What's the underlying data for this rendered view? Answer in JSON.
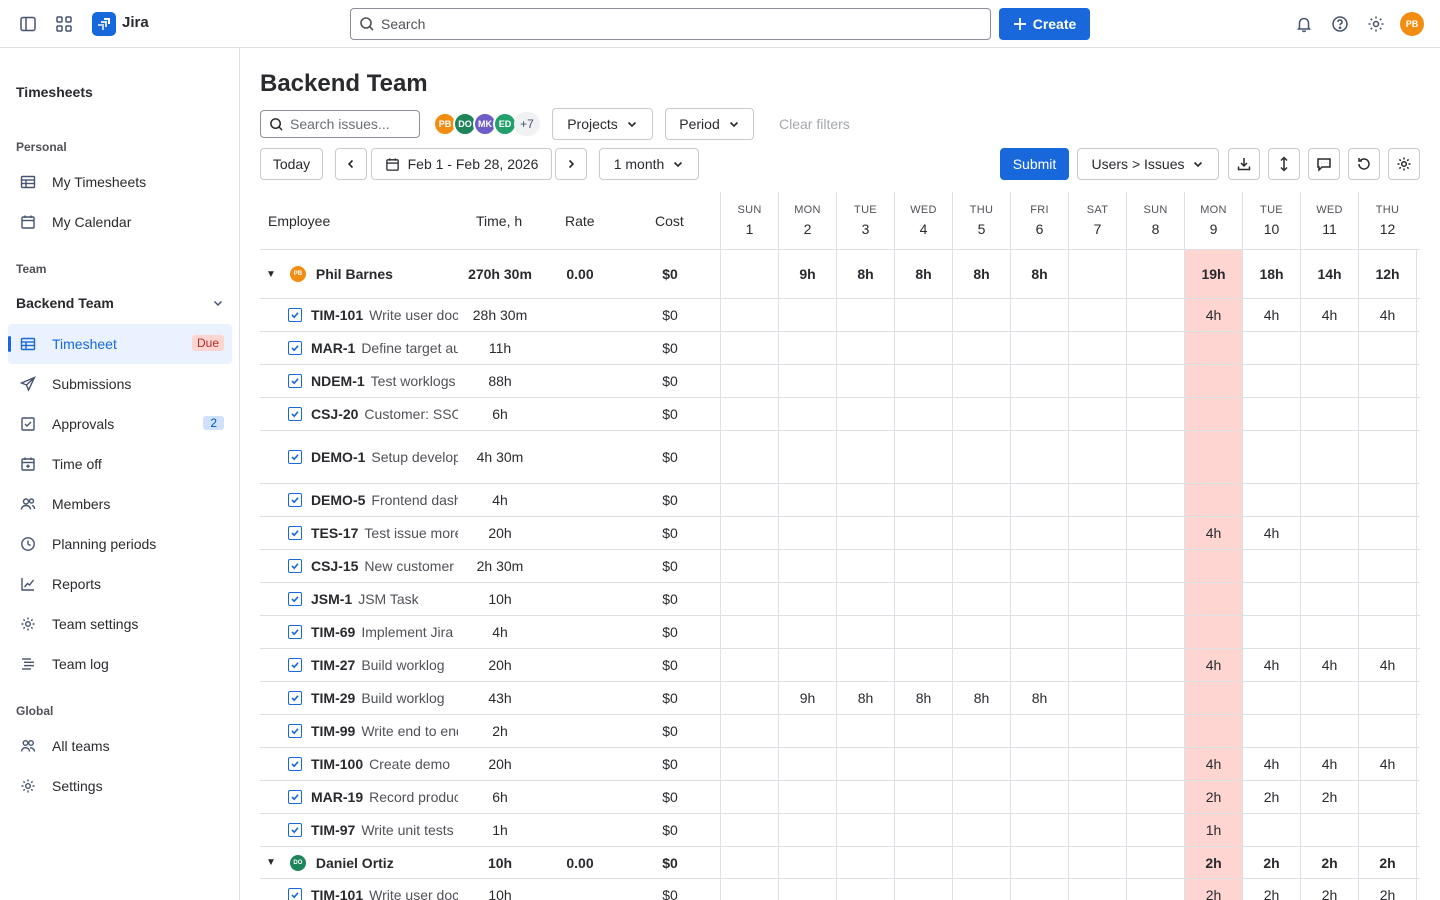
{
  "topbar": {
    "app_name": "Jira",
    "search_placeholder": "Search",
    "create_label": "Create",
    "user_initials": "PB"
  },
  "sidebar": {
    "title": "Timesheets",
    "section_personal": "Personal",
    "personal_items": [
      "My Timesheets",
      "My Calendar"
    ],
    "section_team": "Team",
    "team_name": "Backend Team",
    "team_items": [
      {
        "label": "Timesheet",
        "badge": "Due",
        "icon": "table-icon"
      },
      {
        "label": "Submissions",
        "badge": "",
        "icon": "send-icon"
      },
      {
        "label": "Approvals",
        "badge": "2",
        "icon": "check-square-icon"
      },
      {
        "label": "Time off",
        "badge": "",
        "icon": "calendar-plus-icon"
      },
      {
        "label": "Members",
        "badge": "",
        "icon": "people-icon"
      },
      {
        "label": "Planning periods",
        "badge": "",
        "icon": "clock-icon"
      },
      {
        "label": "Reports",
        "badge": "",
        "icon": "chart-icon"
      },
      {
        "label": "Team settings",
        "badge": "",
        "icon": "gear-icon"
      },
      {
        "label": "Team log",
        "badge": "",
        "icon": "list-icon"
      }
    ],
    "section_global": "Global",
    "global_items": [
      "All teams",
      "Settings"
    ]
  },
  "main": {
    "title": "Backend Team",
    "search_issues_placeholder": "Search issues...",
    "avatars": [
      {
        "initials": "PB",
        "color": "#f18d13"
      },
      {
        "initials": "DO",
        "color": "#1f845a"
      },
      {
        "initials": "MK",
        "color": "#6e5dc6"
      },
      {
        "initials": "ED",
        "color": "#22a06b"
      }
    ],
    "avatars_more": "+7",
    "projects_label": "Projects",
    "period_label": "Period",
    "clear_filters_label": "Clear filters",
    "today_label": "Today",
    "date_range": "Feb 1 - Feb 28, 2026",
    "span_label": "1 month",
    "submit_label": "Submit",
    "grouping_label": "Users > Issues"
  },
  "grid": {
    "columns": {
      "employee": "Employee",
      "time": "Time, h",
      "rate": "Rate",
      "cost": "Cost"
    },
    "days": [
      {
        "dow": "SUN",
        "dom": "1"
      },
      {
        "dow": "MON",
        "dom": "2"
      },
      {
        "dow": "TUE",
        "dom": "3"
      },
      {
        "dow": "WED",
        "dom": "4"
      },
      {
        "dow": "THU",
        "dom": "5"
      },
      {
        "dow": "FRI",
        "dom": "6"
      },
      {
        "dow": "SAT",
        "dom": "7"
      },
      {
        "dow": "SUN",
        "dom": "8"
      },
      {
        "dow": "MON",
        "dom": "9"
      },
      {
        "dow": "TUE",
        "dom": "10"
      },
      {
        "dow": "WED",
        "dom": "11"
      },
      {
        "dow": "THU",
        "dom": "12"
      }
    ],
    "highlight_day_index": 8,
    "highlight_color": "#ffd5d2",
    "rows": [
      {
        "type": "group",
        "name": "Phil Barnes",
        "initials": "PB",
        "avatar_color": "#f18d13",
        "time": "270h 30m",
        "rate": "0.00",
        "cost": "$0",
        "days": [
          "",
          "9h",
          "8h",
          "8h",
          "8h",
          "8h",
          "",
          "",
          "19h",
          "18h",
          "14h",
          "12h"
        ]
      },
      {
        "type": "issue",
        "key": "TIM-101",
        "summary": "Write user docs",
        "time": "28h 30m",
        "cost": "$0",
        "days": [
          "",
          "",
          "",
          "",
          "",
          "",
          "",
          "",
          "4h",
          "4h",
          "4h",
          "4h"
        ]
      },
      {
        "type": "issue",
        "key": "MAR-1",
        "summary": "Define target audience",
        "time": "11h",
        "cost": "$0",
        "days": [
          "",
          "",
          "",
          "",
          "",
          "",
          "",
          "",
          "",
          "",
          "",
          ""
        ]
      },
      {
        "type": "issue",
        "key": "NDEM-1",
        "summary": "Test worklogs",
        "time": "88h",
        "cost": "$0",
        "days": [
          "",
          "",
          "",
          "",
          "",
          "",
          "",
          "",
          "",
          "",
          "",
          ""
        ]
      },
      {
        "type": "issue",
        "key": "CSJ-20",
        "summary": "Customer: SSO",
        "time": "6h",
        "cost": "$0",
        "days": [
          "",
          "",
          "",
          "",
          "",
          "",
          "",
          "",
          "",
          "",
          "",
          ""
        ]
      },
      {
        "type": "issue",
        "key": "DEMO-1",
        "summary": "Setup development",
        "time": "4h 30m",
        "cost": "$0",
        "days": [
          "",
          "",
          "",
          "",
          "",
          "",
          "",
          "",
          "",
          "",
          "",
          ""
        ]
      },
      {
        "type": "issue",
        "key": "DEMO-5",
        "summary": "Frontend dashboard",
        "time": "4h",
        "cost": "$0",
        "days": [
          "",
          "",
          "",
          "",
          "",
          "",
          "",
          "",
          "",
          "",
          "",
          ""
        ]
      },
      {
        "type": "issue",
        "key": "TES-17",
        "summary": "Test issue more",
        "time": "20h",
        "cost": "$0",
        "days": [
          "",
          "",
          "",
          "",
          "",
          "",
          "",
          "",
          "4h",
          "4h",
          "",
          ""
        ]
      },
      {
        "type": "issue",
        "key": "CSJ-15",
        "summary": "New customer",
        "time": "2h 30m",
        "cost": "$0",
        "days": [
          "",
          "",
          "",
          "",
          "",
          "",
          "",
          "",
          "",
          "",
          "",
          ""
        ]
      },
      {
        "type": "issue",
        "key": "JSM-1",
        "summary": "JSM Task",
        "time": "10h",
        "cost": "$0",
        "days": [
          "",
          "",
          "",
          "",
          "",
          "",
          "",
          "",
          "",
          "",
          "",
          ""
        ]
      },
      {
        "type": "issue",
        "key": "TIM-69",
        "summary": "Implement Jira",
        "time": "4h",
        "cost": "$0",
        "days": [
          "",
          "",
          "",
          "",
          "",
          "",
          "",
          "",
          "",
          "",
          "",
          ""
        ]
      },
      {
        "type": "issue",
        "key": "TIM-27",
        "summary": "Build worklog",
        "time": "20h",
        "cost": "$0",
        "days": [
          "",
          "",
          "",
          "",
          "",
          "",
          "",
          "",
          "4h",
          "4h",
          "4h",
          "4h"
        ]
      },
      {
        "type": "issue",
        "key": "TIM-29",
        "summary": "Build worklog",
        "time": "43h",
        "cost": "$0",
        "days": [
          "",
          "9h",
          "8h",
          "8h",
          "8h",
          "8h",
          "",
          "",
          "",
          "",
          "",
          ""
        ]
      },
      {
        "type": "issue",
        "key": "TIM-99",
        "summary": "Write end to end",
        "time": "2h",
        "cost": "$0",
        "days": [
          "",
          "",
          "",
          "",
          "",
          "",
          "",
          "",
          "",
          "",
          "",
          ""
        ]
      },
      {
        "type": "issue",
        "key": "TIM-100",
        "summary": "Create demo",
        "time": "20h",
        "cost": "$0",
        "days": [
          "",
          "",
          "",
          "",
          "",
          "",
          "",
          "",
          "4h",
          "4h",
          "4h",
          "4h"
        ]
      },
      {
        "type": "issue",
        "key": "MAR-19",
        "summary": "Record product",
        "time": "6h",
        "cost": "$0",
        "days": [
          "",
          "",
          "",
          "",
          "",
          "",
          "",
          "",
          "2h",
          "2h",
          "2h",
          ""
        ]
      },
      {
        "type": "issue",
        "key": "TIM-97",
        "summary": "Write unit tests",
        "time": "1h",
        "cost": "$0",
        "days": [
          "",
          "",
          "",
          "",
          "",
          "",
          "",
          "",
          "1h",
          "",
          "",
          ""
        ]
      },
      {
        "type": "group",
        "name": "Daniel Ortiz",
        "initials": "DO",
        "avatar_color": "#1f845a",
        "time": "10h",
        "rate": "0.00",
        "cost": "$0",
        "days": [
          "",
          "",
          "",
          "",
          "",
          "",
          "",
          "",
          "2h",
          "2h",
          "2h",
          "2h"
        ]
      },
      {
        "type": "issue",
        "key": "TIM-101",
        "summary": "Write user docs",
        "time": "10h",
        "cost": "$0",
        "days": [
          "",
          "",
          "",
          "",
          "",
          "",
          "",
          "",
          "2h",
          "2h",
          "2h",
          "2h"
        ]
      }
    ]
  }
}
